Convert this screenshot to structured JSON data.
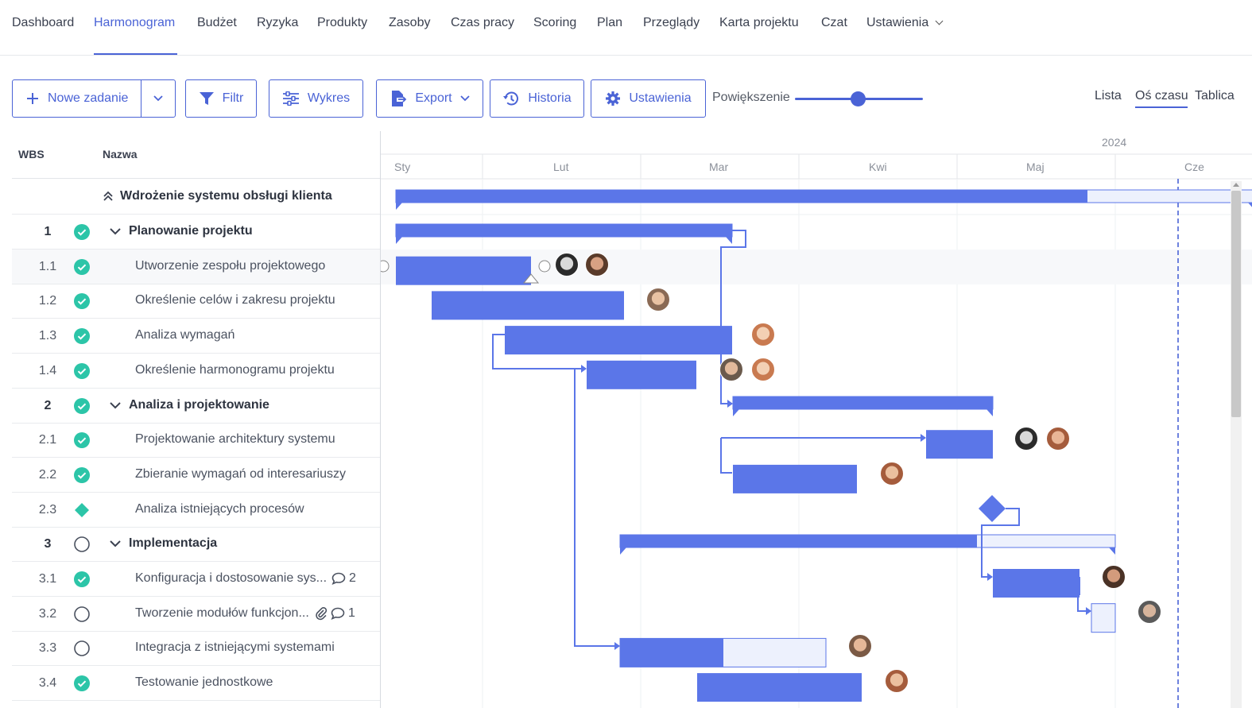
{
  "nav": {
    "items": [
      "Dashboard",
      "Harmonogram",
      "Budżet",
      "Ryzyka",
      "Produkty",
      "Zasoby",
      "Czas pracy",
      "Scoring",
      "Plan",
      "Przeglądy",
      "Karta projektu",
      "Czat",
      "Ustawienia"
    ],
    "active": "Harmonogram"
  },
  "toolbar": {
    "new_task": "Nowe zadanie",
    "filter": "Filtr",
    "chart": "Wykres",
    "export": "Export",
    "history": "Historia",
    "settings": "Ustawienia",
    "zoom_label": "Powiększenie",
    "zoom_level": 0.5,
    "views": [
      "Lista",
      "Oś czasu",
      "Tablica"
    ],
    "active_view": "Oś czasu"
  },
  "grid": {
    "col_wbs": "WBS",
    "col_name": "Nazwa",
    "project": "Wdrożenie systemu obsługi klienta",
    "rows": [
      {
        "wbs": "1",
        "name": "Planowanie projektu",
        "status": "done",
        "group": true
      },
      {
        "wbs": "1.1",
        "name": "Utworzenie zespołu projektowego",
        "status": "done",
        "group": false
      },
      {
        "wbs": "1.2",
        "name": "Określenie celów i zakresu projektu",
        "status": "done",
        "group": false
      },
      {
        "wbs": "1.3",
        "name": "Analiza wymagań",
        "status": "done",
        "group": false
      },
      {
        "wbs": "1.4",
        "name": "Określenie harmonogramu projektu",
        "status": "done",
        "group": false
      },
      {
        "wbs": "2",
        "name": "Analiza i projektowanie",
        "status": "done",
        "group": true
      },
      {
        "wbs": "2.1",
        "name": "Projektowanie architektury systemu",
        "status": "done",
        "group": false
      },
      {
        "wbs": "2.2",
        "name": "Zbieranie wymagań od interesariuszy",
        "status": "done",
        "group": false
      },
      {
        "wbs": "2.3",
        "name": "Analiza istniejących procesów",
        "status": "milestone",
        "group": false
      },
      {
        "wbs": "3",
        "name": "Implementacja",
        "status": "open",
        "group": true
      },
      {
        "wbs": "3.1",
        "name": "Konfiguracja i dostosowanie sys...",
        "status": "done",
        "group": false,
        "comments": "2"
      },
      {
        "wbs": "3.2",
        "name": "Tworzenie modułów funkcjon...",
        "status": "open",
        "group": false,
        "attachment": true,
        "comments": "1"
      },
      {
        "wbs": "3.3",
        "name": "Integracja z istniejącymi systemami",
        "status": "open",
        "group": false
      },
      {
        "wbs": "3.4",
        "name": "Testowanie jednostkowe",
        "status": "done",
        "group": false
      }
    ]
  },
  "timeline": {
    "year": "2024",
    "months": [
      "Sty",
      "Lut",
      "Mar",
      "Kwi",
      "Maj",
      "Cze"
    ]
  },
  "colors": {
    "accent": "#4a63d6",
    "bar": "#5b76e8",
    "bar_light": "#edf1fd",
    "done": "#2cc5a8",
    "milestone": "#2cc5a8"
  }
}
